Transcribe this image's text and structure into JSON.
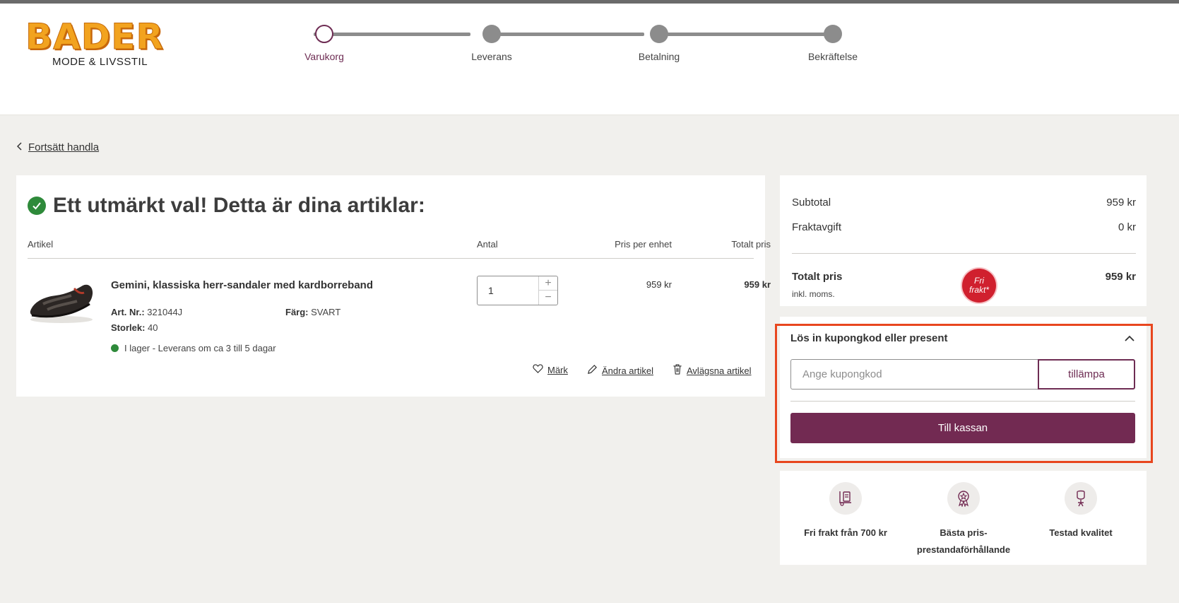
{
  "header": {
    "logo": {
      "word": "BADER",
      "sub": "MODE & LIVSSTIL"
    },
    "steps": [
      {
        "label": "Varukorg",
        "active": true
      },
      {
        "label": "Leverans",
        "active": false
      },
      {
        "label": "Betalning",
        "active": false
      },
      {
        "label": "Bekräftelse",
        "active": false
      }
    ]
  },
  "continue_shopping": "Fortsätt handla",
  "cart": {
    "title": "Ett utmärkt val! Detta är dina artiklar:",
    "columns": {
      "article": "Artikel",
      "quantity": "Antal",
      "unit_price": "Pris per enhet",
      "total_price": "Totalt pris"
    },
    "item": {
      "name": "Gemini, klassiska herr-sandaler med kardborreband",
      "art_label": "Art. Nr.:",
      "art_value": "321044J",
      "color_label": "Färg:",
      "color_value": "SVART",
      "size_label": "Storlek:",
      "size_value": "40",
      "stock": "I lager - Leverans om ca 3 till 5 dagar",
      "quantity": "1",
      "unit_price": "959 kr",
      "total_price": "959 kr",
      "actions": {
        "mark": "Märk",
        "edit": "Ändra artikel",
        "remove": "Avlägsna artikel"
      }
    }
  },
  "summary": {
    "subtotal_label": "Subtotal",
    "subtotal_value": "959 kr",
    "shipping_label": "Fraktavgift",
    "shipping_value": "0 kr",
    "total_label": "Totalt pris",
    "total_sub": "inkl. moms.",
    "total_value": "959 kr",
    "badge_line1": "Fri",
    "badge_line2": "frakt*"
  },
  "coupon": {
    "title": "Lös in kupongkod eller present",
    "placeholder": "Ange kupongkod",
    "apply": "tillämpa",
    "checkout": "Till kassan"
  },
  "usps": [
    {
      "icon": "delivery-icon",
      "label": "Fri frakt från 700 kr"
    },
    {
      "icon": "award-icon",
      "label": "Bästa pris-prestandaförhållande"
    },
    {
      "icon": "quality-icon",
      "label": "Testad kvalitet"
    }
  ],
  "colors": {
    "brand": "#722a52",
    "highlight": "#e8461e",
    "stock": "#2e8a3a",
    "badge": "#d0202e"
  }
}
